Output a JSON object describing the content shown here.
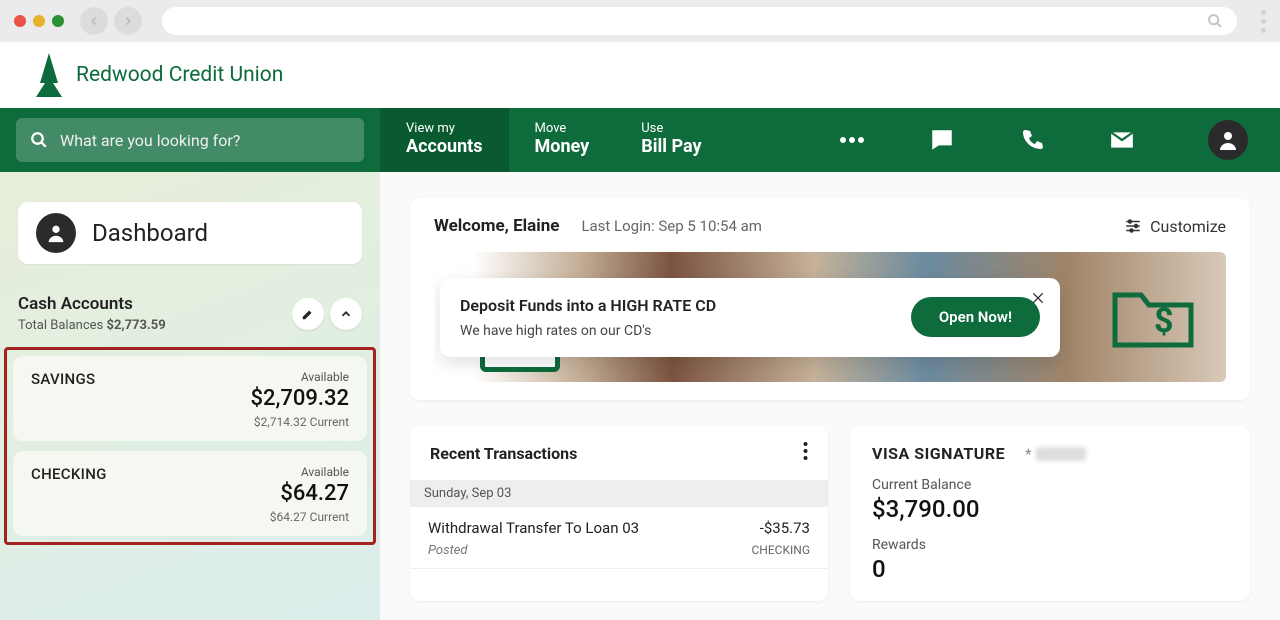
{
  "brand": {
    "name": "Redwood Credit Union"
  },
  "search": {
    "placeholder": "What are you looking for?"
  },
  "nav": {
    "tabs": [
      {
        "small": "View my",
        "big": "Accounts"
      },
      {
        "small": "Move",
        "big": "Money"
      },
      {
        "small": "Use",
        "big": "Bill Pay"
      }
    ]
  },
  "sidebar": {
    "dashboard_label": "Dashboard",
    "cash_accounts_label": "Cash Accounts",
    "total_balances_label": "Total Balances",
    "total_balances_value": "$2,773.59",
    "accounts": [
      {
        "name": "SAVINGS",
        "available_label": "Available",
        "available": "$2,709.32",
        "current": "$2,714.32 Current"
      },
      {
        "name": "CHECKING",
        "available_label": "Available",
        "available": "$64.27",
        "current": "$64.27 Current"
      }
    ]
  },
  "welcome": {
    "greeting": "Welcome, Elaine",
    "last_login": "Last Login: Sep 5 10:54 am",
    "customize_label": "Customize"
  },
  "promo": {
    "title": "Deposit Funds into a HIGH RATE CD",
    "body": "We have high rates on our CD's",
    "cta": "Open Now!"
  },
  "recent": {
    "title": "Recent Transactions",
    "date": "Sunday, Sep 03",
    "txns": [
      {
        "desc": "Withdrawal Transfer To Loan 03",
        "status": "Posted",
        "amount": "-$35.73",
        "account": "CHECKING"
      }
    ]
  },
  "visa": {
    "title": "VISA SIGNATURE",
    "mask": "*",
    "current_balance_label": "Current Balance",
    "current_balance": "$3,790.00",
    "rewards_label": "Rewards",
    "rewards": "0"
  }
}
